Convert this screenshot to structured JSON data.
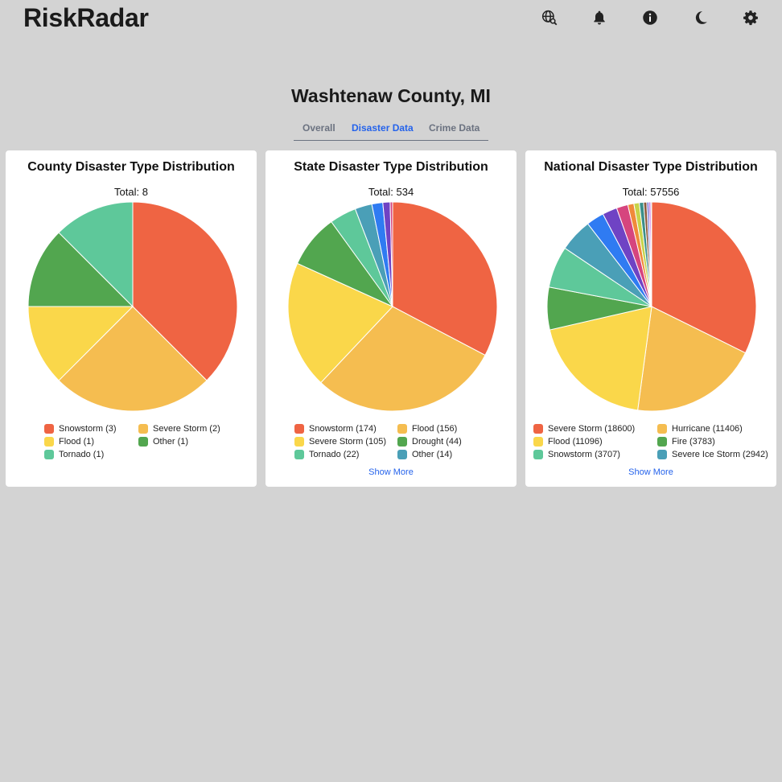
{
  "app": {
    "title": "RiskRadar"
  },
  "header": {
    "icons": [
      "globe-search-icon",
      "bell-icon",
      "info-icon",
      "moon-icon",
      "gear-icon"
    ]
  },
  "location": {
    "title": "Washtenaw County, MI"
  },
  "tabs": [
    {
      "label": "Overall",
      "active": false
    },
    {
      "label": "Disaster Data",
      "active": true
    },
    {
      "label": "Crime Data",
      "active": false
    }
  ],
  "colors": {
    "accent": "#2563eb",
    "palette": [
      "#ef6443",
      "#f5bd50",
      "#fad74a",
      "#52a64f",
      "#5ec89a",
      "#4a9fb7",
      "#2f7bf2",
      "#6f43c4",
      "#d6457e",
      "#f08a3a",
      "#c7d34a",
      "#3b8f8a",
      "#8a5a3c",
      "#7b7bd9",
      "#b34ad6",
      "#888888"
    ]
  },
  "cards": [
    {
      "title": "County Disaster Type Distribution",
      "total_text": "Total: 8",
      "show_more": "",
      "legend": [
        {
          "label": "Snowstorm (3)",
          "color": "#ef6443"
        },
        {
          "label": "Severe Storm (2)",
          "color": "#f5bd50"
        },
        {
          "label": "Flood (1)",
          "color": "#fad74a"
        },
        {
          "label": "Other (1)",
          "color": "#52a64f"
        },
        {
          "label": "Tornado (1)",
          "color": "#5ec89a"
        }
      ]
    },
    {
      "title": "State Disaster Type Distribution",
      "total_text": "Total: 534",
      "show_more": "Show More",
      "legend": [
        {
          "label": "Snowstorm (174)",
          "color": "#ef6443"
        },
        {
          "label": "Flood (156)",
          "color": "#f5bd50"
        },
        {
          "label": "Severe Storm (105)",
          "color": "#fad74a"
        },
        {
          "label": "Drought (44)",
          "color": "#52a64f"
        },
        {
          "label": "Tornado (22)",
          "color": "#5ec89a"
        },
        {
          "label": "Other (14)",
          "color": "#4a9fb7"
        }
      ]
    },
    {
      "title": "National Disaster Type Distribution",
      "total_text": "Total: 57556",
      "show_more": "Show More",
      "legend": [
        {
          "label": "Severe Storm (18600)",
          "color": "#ef6443"
        },
        {
          "label": "Hurricane (11406)",
          "color": "#f5bd50"
        },
        {
          "label": "Flood (11096)",
          "color": "#fad74a"
        },
        {
          "label": "Fire (3783)",
          "color": "#52a64f"
        },
        {
          "label": "Snowstorm (3707)",
          "color": "#5ec89a"
        },
        {
          "label": "Severe Ice Storm (2942)",
          "color": "#4a9fb7"
        }
      ]
    }
  ],
  "chart_data": [
    {
      "type": "pie",
      "title": "County Disaster Type Distribution",
      "labels": [
        "Snowstorm",
        "Severe Storm",
        "Flood",
        "Other",
        "Tornado"
      ],
      "values": [
        3,
        2,
        1,
        1,
        1
      ],
      "colors": [
        "#ef6443",
        "#f5bd50",
        "#fad74a",
        "#52a64f",
        "#5ec89a"
      ]
    },
    {
      "type": "pie",
      "title": "State Disaster Type Distribution",
      "labels": [
        "Snowstorm",
        "Flood",
        "Severe Storm",
        "Drought",
        "Tornado",
        "Other",
        "",
        "",
        ""
      ],
      "values": [
        174,
        156,
        105,
        44,
        22,
        14,
        9,
        6,
        2
      ],
      "colors": [
        "#ef6443",
        "#f5bd50",
        "#fad74a",
        "#52a64f",
        "#5ec89a",
        "#4a9fb7",
        "#2f7bf2",
        "#6f43c4",
        "#d6457e"
      ]
    },
    {
      "type": "pie",
      "title": "National Disaster Type Distribution",
      "labels": [
        "Severe Storm",
        "Hurricane",
        "Flood",
        "Fire",
        "Snowstorm",
        "Severe Ice Storm",
        "",
        "",
        "",
        "",
        "",
        "",
        "",
        "",
        "",
        ""
      ],
      "values": [
        18600,
        11406,
        11096,
        3783,
        3707,
        2942,
        1580,
        1310,
        1020,
        540,
        480,
        380,
        280,
        200,
        150,
        82
      ],
      "colors": [
        "#ef6443",
        "#f5bd50",
        "#fad74a",
        "#52a64f",
        "#5ec89a",
        "#4a9fb7",
        "#2f7bf2",
        "#6f43c4",
        "#d6457e",
        "#f08a3a",
        "#c7d34a",
        "#3b8f8a",
        "#8a5a3c",
        "#7b7bd9",
        "#b34ad6",
        "#888888"
      ]
    }
  ]
}
